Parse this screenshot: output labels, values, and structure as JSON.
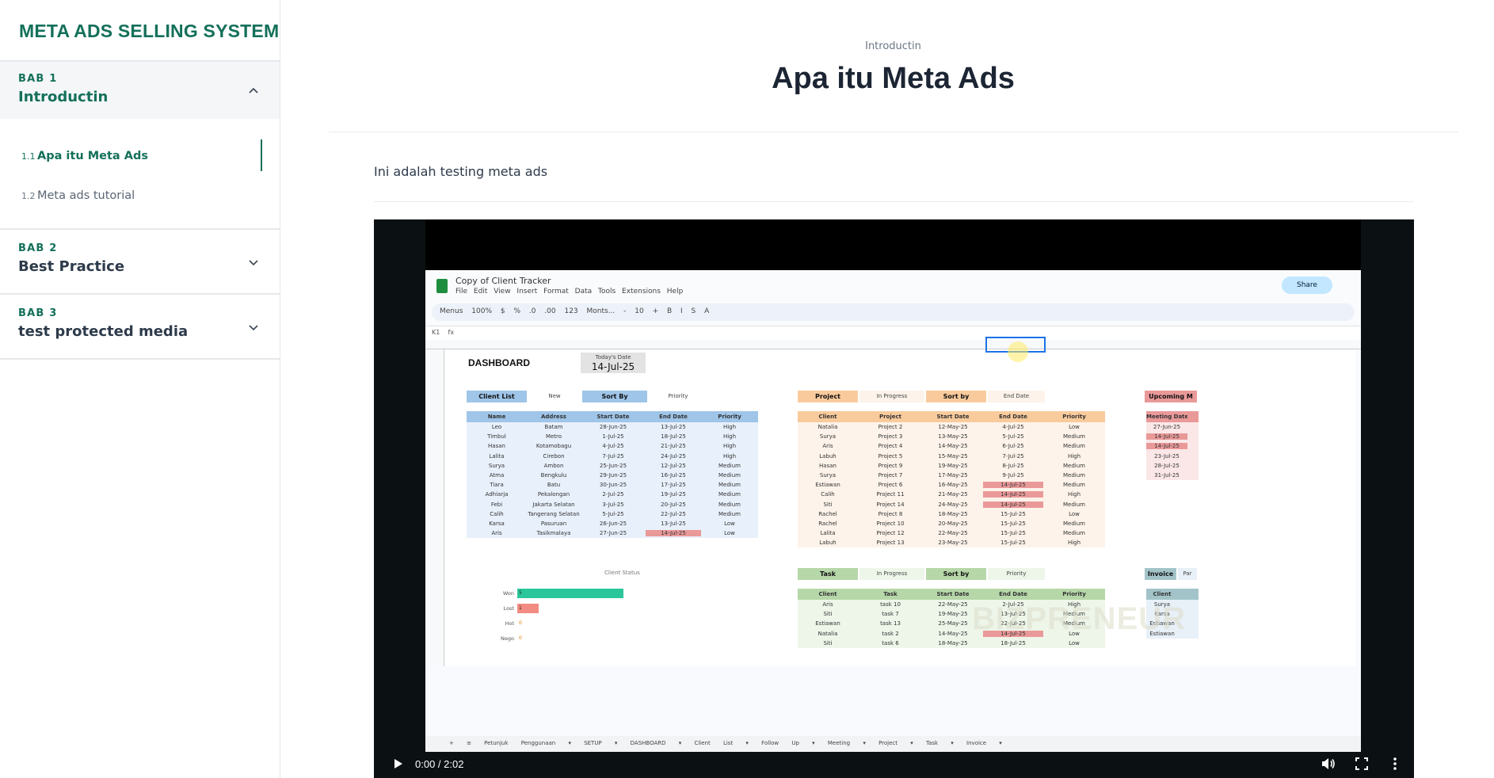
{
  "sidebar": {
    "brand": "META ADS SELLING SYSTEM",
    "chapters": [
      {
        "bab": "BAB 1",
        "title": "Introductin",
        "expanded": true,
        "lessons": [
          {
            "num": "1.1",
            "label": "Apa itu Meta Ads",
            "active": true
          },
          {
            "num": "1.2",
            "label": "Meta ads tutorial",
            "active": false
          }
        ]
      },
      {
        "bab": "BAB 2",
        "title": "Best Practice",
        "expanded": false
      },
      {
        "bab": "BAB 3",
        "title": "test protected media",
        "expanded": false
      }
    ]
  },
  "main": {
    "breadcrumb": "Introductin",
    "title": "Apa itu Meta Ads",
    "body": "Ini adalah testing meta ads"
  },
  "video": {
    "time": "0:00 / 2:02",
    "frame": {
      "doc_name": "Copy of Client Tracker",
      "menu": "File Edit View Insert Format Data Tools Extensions Help",
      "share": "Share",
      "toolbar": "Menus  100%  $  %  .0  .00  123  Monts...  -  10  +  B  I  S  A",
      "cell_ref": "K1",
      "dashboard": "DASHBOARD",
      "today_label": "Today's Date",
      "today_value": "14-Jul-25",
      "client_list": {
        "label": "Client List",
        "filter1": "New",
        "sort_label": "Sort By",
        "filter2": "Priority",
        "headers": [
          "Name",
          "Address",
          "Start Date",
          "End Date",
          "Priority"
        ],
        "rows": [
          [
            "Leo",
            "Batam",
            "28-Jun-25",
            "13-Jul-25",
            "High"
          ],
          [
            "Timbul",
            "Metro",
            "1-Jul-25",
            "18-Jul-25",
            "High"
          ],
          [
            "Hasan",
            "Kotamobagu",
            "4-Jul-25",
            "21-Jul-25",
            "High"
          ],
          [
            "Lalita",
            "Cirebon",
            "7-Jul-25",
            "24-Jul-25",
            "High"
          ],
          [
            "Surya",
            "Ambon",
            "25-Jun-25",
            "12-Jul-25",
            "Medium"
          ],
          [
            "Atma",
            "Bengkulu",
            "29-Jun-25",
            "16-Jul-25",
            "Medium"
          ],
          [
            "Tiara",
            "Batu",
            "30-Jun-25",
            "17-Jul-25",
            "Medium"
          ],
          [
            "Adhiarja",
            "Pekalongan",
            "2-Jul-25",
            "19-Jul-25",
            "Medium"
          ],
          [
            "Febi",
            "Jakarta Selatan",
            "3-Jul-25",
            "20-Jul-25",
            "Medium"
          ],
          [
            "Calih",
            "Tangerang Selatan",
            "5-Jul-25",
            "22-Jul-25",
            "Medium"
          ],
          [
            "Karsa",
            "Pasuruan",
            "26-Jun-25",
            "13-Jul-25",
            "Low"
          ],
          [
            "Aris",
            "Tasikmalaya",
            "27-Jun-25",
            "14-Jul-25",
            "Low"
          ]
        ]
      },
      "project": {
        "label": "Project",
        "filter1": "In Progress",
        "sort_label": "Sort by",
        "filter2": "End Date",
        "headers": [
          "Client",
          "Project",
          "Start Date",
          "End Date",
          "Priority"
        ],
        "rows": [
          [
            "Natalia",
            "Project 2",
            "12-May-25",
            "4-Jul-25",
            "Low"
          ],
          [
            "Surya",
            "Project 3",
            "13-May-25",
            "5-Jul-25",
            "Medium"
          ],
          [
            "Aris",
            "Project 4",
            "14-May-25",
            "6-Jul-25",
            "Medium"
          ],
          [
            "Labuh",
            "Project 5",
            "15-May-25",
            "7-Jul-25",
            "High"
          ],
          [
            "Hasan",
            "Project 9",
            "19-May-25",
            "8-Jul-25",
            "Medium"
          ],
          [
            "Surya",
            "Project 7",
            "17-May-25",
            "9-Jul-25",
            "Medium"
          ],
          [
            "Estiawan",
            "Project 6",
            "16-May-25",
            "14-Jul-25",
            "Medium"
          ],
          [
            "Calih",
            "Project 11",
            "21-May-25",
            "14-Jul-25",
            "High"
          ],
          [
            "Siti",
            "Project 14",
            "24-May-25",
            "14-Jul-25",
            "Medium"
          ],
          [
            "Rachel",
            "Project 8",
            "18-May-25",
            "15-Jul-25",
            "Low"
          ],
          [
            "Rachel",
            "Project 10",
            "20-May-25",
            "15-Jul-25",
            "Medium"
          ],
          [
            "Lalita",
            "Project 12",
            "22-May-25",
            "15-Jul-25",
            "Medium"
          ],
          [
            "Labuh",
            "Project 13",
            "23-May-25",
            "15-Jul-25",
            "High"
          ]
        ]
      },
      "meeting": {
        "label": "Upcoming M",
        "header": "Meeting Date",
        "rows": [
          "27-Jun-25",
          "14-Jul-25",
          "14-Jul-25",
          "23-Jul-25",
          "28-Jul-25",
          "31-Jul-25"
        ]
      },
      "task": {
        "label": "Task",
        "filter1": "In Progress",
        "sort_label": "Sort by",
        "filter2": "Priority",
        "headers": [
          "Client",
          "Task",
          "Start Date",
          "End Date",
          "Priority"
        ],
        "rows": [
          [
            "Aris",
            "task 10",
            "22-May-25",
            "2-Jul-25",
            "High"
          ],
          [
            "Siti",
            "task 7",
            "19-May-25",
            "13-Jul-25",
            "Medium"
          ],
          [
            "Estiawan",
            "task 13",
            "25-May-25",
            "22-Jul-25",
            "Medium"
          ],
          [
            "Natalia",
            "task 2",
            "14-May-25",
            "14-Jul-25",
            "Low"
          ],
          [
            "Siti",
            "task 6",
            "18-May-25",
            "18-Jul-25",
            "Low"
          ]
        ]
      },
      "invoice": {
        "label": "Invoice",
        "label2": "Par",
        "header": "Client",
        "rows": [
          "Surya",
          "Karsa",
          "Estiawan",
          "Estiawan"
        ]
      },
      "client_status": {
        "title": "Client Status",
        "bars": [
          {
            "key": "Won",
            "value": 5
          },
          {
            "key": "Lost",
            "value": 1
          },
          {
            "key": "Hot",
            "value": 0
          },
          {
            "key": "Nego",
            "value": 0
          }
        ]
      },
      "watermark": "BIZPRENEUR",
      "sheet_tabs": "+  ≡  Petunjuk Penggunaan ▾  SETUP ▾  DASHBOARD ▾  Client List ▾  Follow Up ▾  Meeting ▾  Project ▾  Task ▾  Invoice ▾"
    }
  },
  "colors": {
    "accent": "#14705a",
    "text": "#1c2533",
    "video_bg": "#0b1013"
  }
}
